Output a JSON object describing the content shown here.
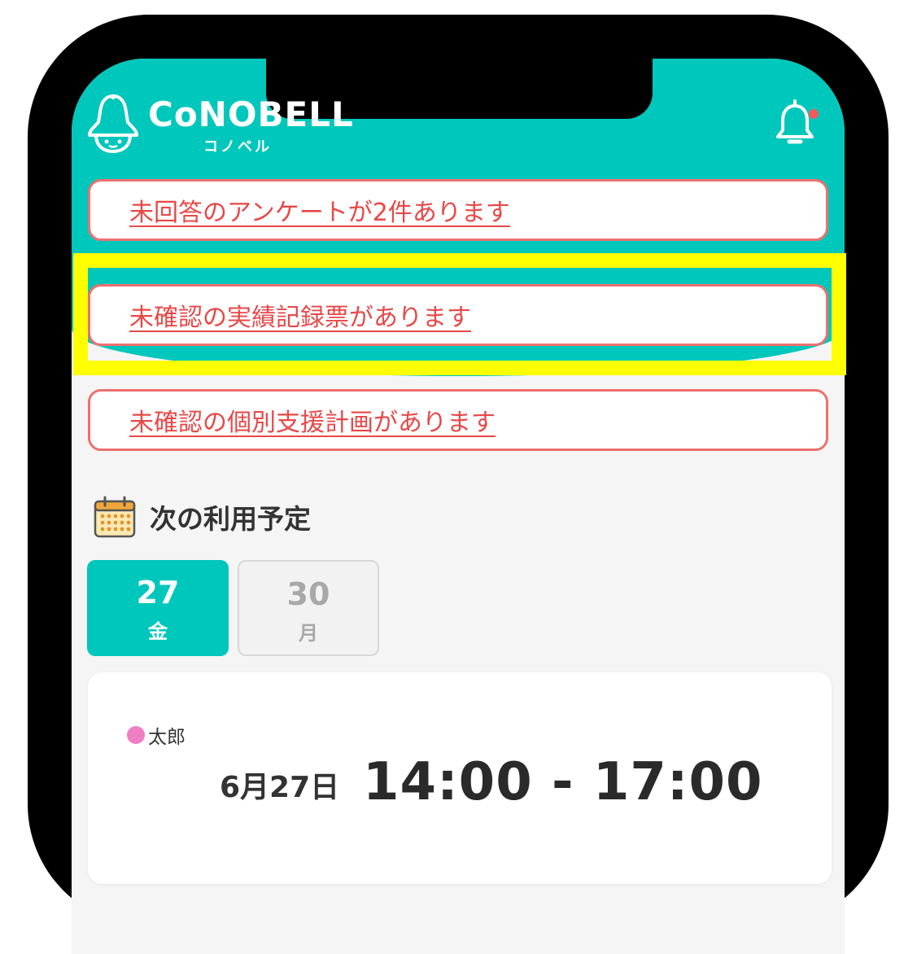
{
  "header": {
    "logo_text": "CoNOBELL",
    "logo_subtitle": "コノベル",
    "notification_icon": "bell-icon",
    "notification_dot_color": "#f05a5a"
  },
  "alerts": [
    {
      "text": "未回答のアンケートが2件あります"
    },
    {
      "text": "未確認の実績記録票があります",
      "highlighted": true
    },
    {
      "text": "未確認の個別支援計画があります"
    }
  ],
  "schedule": {
    "section_title": "次の利用予定",
    "section_icon": "calendar-icon",
    "tabs": [
      {
        "day": "27",
        "weekday": "金",
        "selected": true
      },
      {
        "day": "30",
        "weekday": "月",
        "selected": false
      }
    ],
    "card": {
      "child_name": "太郎",
      "child_color": "#f07ec4",
      "date": "6月27日",
      "time": "14:00 - 17:00"
    }
  },
  "colors": {
    "brand": "#00c7bb",
    "alert_text": "#e84848",
    "alert_border": "#ee7070",
    "highlight": "#ffff00"
  }
}
